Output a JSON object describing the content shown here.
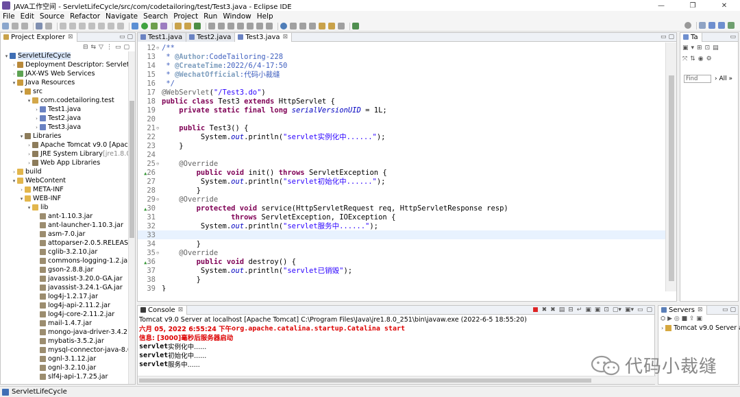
{
  "window": {
    "title": "JAVA工作空间 - ServletLifeCycle/src/com/codetailoring/test/Test3.java - Eclipse IDE",
    "controls": [
      "—",
      "❐",
      "✕"
    ]
  },
  "menu": [
    "File",
    "Edit",
    "Source",
    "Refactor",
    "Navigate",
    "Search",
    "Project",
    "Run",
    "Window",
    "Help"
  ],
  "explorer": {
    "tab_label": "Project Explorer",
    "tree": [
      {
        "label": "ServletLifeCycle",
        "depth": 0,
        "arrow": "▾",
        "icon": "project-icon",
        "selected": true
      },
      {
        "label": "Deployment Descriptor: ServletLifec",
        "depth": 1,
        "arrow": "›",
        "icon": "descriptor-icon"
      },
      {
        "label": "JAX-WS Web Services",
        "depth": 1,
        "arrow": "›",
        "icon": "webservice-icon"
      },
      {
        "label": "Java Resources",
        "depth": 1,
        "arrow": "▾",
        "icon": "resources-icon"
      },
      {
        "label": "src",
        "depth": 2,
        "arrow": "▾",
        "icon": "source-folder-icon"
      },
      {
        "label": "com.codetailoring.test",
        "depth": 3,
        "arrow": "▾",
        "icon": "package-icon"
      },
      {
        "label": "Test1.java",
        "depth": 4,
        "arrow": "›",
        "icon": "java-file-icon"
      },
      {
        "label": "Test2.java",
        "depth": 4,
        "arrow": "›",
        "icon": "java-file-icon"
      },
      {
        "label": "Test3.java",
        "depth": 4,
        "arrow": "›",
        "icon": "java-file-icon"
      },
      {
        "label": "Libraries",
        "depth": 2,
        "arrow": "▾",
        "icon": "library-icon"
      },
      {
        "label": "Apache Tomcat v9.0 [Apache T",
        "depth": 3,
        "arrow": "›",
        "icon": "library-icon"
      },
      {
        "label": "JRE System Library ",
        "suffix": "[jre1.8.0_25",
        "depth": 3,
        "arrow": "›",
        "icon": "library-icon"
      },
      {
        "label": "Web App Libraries",
        "depth": 3,
        "arrow": "›",
        "icon": "library-icon"
      },
      {
        "label": "build",
        "depth": 1,
        "arrow": "›",
        "icon": "folder-icon"
      },
      {
        "label": "WebContent",
        "depth": 1,
        "arrow": "▾",
        "icon": "folder-icon"
      },
      {
        "label": "META-INF",
        "depth": 2,
        "arrow": "›",
        "icon": "folder-icon"
      },
      {
        "label": "WEB-INF",
        "depth": 2,
        "arrow": "▾",
        "icon": "folder-icon"
      },
      {
        "label": "lib",
        "depth": 3,
        "arrow": "▾",
        "icon": "folder-icon"
      },
      {
        "label": "ant-1.10.3.jar",
        "depth": 4,
        "arrow": "",
        "icon": "jar-icon"
      },
      {
        "label": "ant-launcher-1.10.3.jar",
        "depth": 4,
        "arrow": "",
        "icon": "jar-icon"
      },
      {
        "label": "asm-7.0.jar",
        "depth": 4,
        "arrow": "",
        "icon": "jar-icon"
      },
      {
        "label": "attoparser-2.0.5.RELEASE.ja",
        "depth": 4,
        "arrow": "",
        "icon": "jar-icon"
      },
      {
        "label": "cglib-3.2.10.jar",
        "depth": 4,
        "arrow": "",
        "icon": "jar-icon"
      },
      {
        "label": "commons-logging-1.2.jar",
        "depth": 4,
        "arrow": "",
        "icon": "jar-icon"
      },
      {
        "label": "gson-2.8.8.jar",
        "depth": 4,
        "arrow": "",
        "icon": "jar-icon"
      },
      {
        "label": "javassist-3.20.0-GA.jar",
        "depth": 4,
        "arrow": "",
        "icon": "jar-icon"
      },
      {
        "label": "javassist-3.24.1-GA.jar",
        "depth": 4,
        "arrow": "",
        "icon": "jar-icon"
      },
      {
        "label": "log4j-1.2.17.jar",
        "depth": 4,
        "arrow": "",
        "icon": "jar-icon"
      },
      {
        "label": "log4j-api-2.11.2.jar",
        "depth": 4,
        "arrow": "",
        "icon": "jar-icon"
      },
      {
        "label": "log4j-core-2.11.2.jar",
        "depth": 4,
        "arrow": "",
        "icon": "jar-icon"
      },
      {
        "label": "mail-1.4.7.jar",
        "depth": 4,
        "arrow": "",
        "icon": "jar-icon"
      },
      {
        "label": "mongo-java-driver-3.4.2.jar",
        "depth": 4,
        "arrow": "",
        "icon": "jar-icon"
      },
      {
        "label": "mybatis-3.5.2.jar",
        "depth": 4,
        "arrow": "",
        "icon": "jar-icon"
      },
      {
        "label": "mysql-connector-java-8.0.1",
        "depth": 4,
        "arrow": "",
        "icon": "jar-icon"
      },
      {
        "label": "ognl-3.1.12.jar",
        "depth": 4,
        "arrow": "",
        "icon": "jar-icon"
      },
      {
        "label": "ognl-3.2.10.jar",
        "depth": 4,
        "arrow": "",
        "icon": "jar-icon"
      },
      {
        "label": "slf4j-api-1.7.25.jar",
        "depth": 4,
        "arrow": "",
        "icon": "jar-icon"
      }
    ]
  },
  "editor": {
    "tabs": [
      {
        "label": "Test1.java",
        "active": false
      },
      {
        "label": "Test2.java",
        "active": false
      },
      {
        "label": "Test3.java",
        "active": true
      }
    ],
    "lines": [
      {
        "n": "12",
        "fold": "⊖",
        "parts": [
          [
            "cm",
            "/**"
          ]
        ]
      },
      {
        "n": "13",
        "parts": [
          [
            "cm",
            " * "
          ],
          [
            "tag",
            "@Author"
          ],
          [
            "cm",
            ":CodeTailoring-228"
          ]
        ]
      },
      {
        "n": "14",
        "parts": [
          [
            "cm",
            " * "
          ],
          [
            "tag",
            "@CreateTime"
          ],
          [
            "cm",
            ":2022/6/4-17:50"
          ]
        ]
      },
      {
        "n": "15",
        "parts": [
          [
            "cm",
            " * "
          ],
          [
            "tag",
            "@WechatOfficial"
          ],
          [
            "cm",
            ":代码小裁缝"
          ]
        ]
      },
      {
        "n": "16",
        "parts": [
          [
            "cm",
            " */"
          ]
        ]
      },
      {
        "n": "17",
        "parts": [
          [
            "ann",
            "@WebServlet"
          ],
          [
            "",
            "("
          ],
          [
            "str",
            "\"/Test3.do\""
          ],
          [
            "",
            ")"
          ]
        ]
      },
      {
        "n": "18",
        "parts": [
          [
            "kw",
            "public class "
          ],
          [
            "",
            "Test3 "
          ],
          [
            "kw",
            "extends "
          ],
          [
            "",
            "HttpServlet {"
          ]
        ]
      },
      {
        "n": "19",
        "parts": [
          [
            "",
            "    "
          ],
          [
            "kw",
            "private static final long "
          ],
          [
            "fld",
            "serialVersionUID"
          ],
          [
            "",
            " = 1L;"
          ]
        ]
      },
      {
        "n": "20",
        "parts": [
          [
            "",
            ""
          ]
        ]
      },
      {
        "n": "21",
        "fold": "⊖",
        "parts": [
          [
            "",
            "    "
          ],
          [
            "kw",
            "public "
          ],
          [
            "",
            "Test3() {"
          ]
        ]
      },
      {
        "n": "22",
        "parts": [
          [
            "",
            "         System."
          ],
          [
            "stf",
            "out"
          ],
          [
            "",
            ".println("
          ],
          [
            "str",
            "\"servlet实例化中......\""
          ],
          [
            "",
            ");"
          ]
        ]
      },
      {
        "n": "23",
        "parts": [
          [
            "",
            "    }"
          ]
        ]
      },
      {
        "n": "24",
        "parts": [
          [
            "",
            ""
          ]
        ]
      },
      {
        "n": "25",
        "fold": "⊖",
        "parts": [
          [
            "",
            "    "
          ],
          [
            "ann",
            "@Override"
          ]
        ]
      },
      {
        "n": "26",
        "marker": "▲",
        "parts": [
          [
            "",
            "        "
          ],
          [
            "kw",
            "public void "
          ],
          [
            "",
            "init() "
          ],
          [
            "kw",
            "throws "
          ],
          [
            "",
            "ServletException {"
          ]
        ]
      },
      {
        "n": "27",
        "parts": [
          [
            "",
            "         System."
          ],
          [
            "stf",
            "out"
          ],
          [
            "",
            ".println("
          ],
          [
            "str",
            "\"servlet初始化中......\""
          ],
          [
            "",
            ");"
          ]
        ]
      },
      {
        "n": "28",
        "parts": [
          [
            "",
            "        }"
          ]
        ]
      },
      {
        "n": "29",
        "fold": "⊖",
        "parts": [
          [
            "",
            "    "
          ],
          [
            "ann",
            "@Override"
          ]
        ]
      },
      {
        "n": "30",
        "marker": "▲",
        "parts": [
          [
            "",
            "        "
          ],
          [
            "kw",
            "protected void "
          ],
          [
            "",
            "service(HttpServletRequest req, HttpServletResponse resp)"
          ]
        ]
      },
      {
        "n": "31",
        "parts": [
          [
            "",
            "                "
          ],
          [
            "kw",
            "throws "
          ],
          [
            "",
            "ServletException, IOException {"
          ]
        ]
      },
      {
        "n": "32",
        "parts": [
          [
            "",
            "         System."
          ],
          [
            "stf",
            "out"
          ],
          [
            "",
            ".println("
          ],
          [
            "str",
            "\"servlet服务中......\""
          ],
          [
            "",
            ");"
          ]
        ]
      },
      {
        "n": "33",
        "hl": true,
        "parts": [
          [
            "",
            ""
          ]
        ]
      },
      {
        "n": "34",
        "parts": [
          [
            "",
            "        }"
          ]
        ]
      },
      {
        "n": "35",
        "fold": "⊖",
        "parts": [
          [
            "",
            "    "
          ],
          [
            "ann",
            "@Override"
          ]
        ]
      },
      {
        "n": "36",
        "marker": "▲",
        "parts": [
          [
            "",
            "        "
          ],
          [
            "kw",
            "public void "
          ],
          [
            "",
            "destroy() {"
          ]
        ]
      },
      {
        "n": "37",
        "parts": [
          [
            "",
            "         System."
          ],
          [
            "stf",
            "out"
          ],
          [
            "",
            ".println("
          ],
          [
            "str",
            "\"servlet已销毁\""
          ],
          [
            "",
            ");"
          ]
        ]
      },
      {
        "n": "38",
        "parts": [
          [
            "",
            "        }"
          ]
        ]
      },
      {
        "n": "39",
        "parts": [
          [
            "",
            "}"
          ]
        ]
      }
    ]
  },
  "outline": {
    "tab_label": "Ta",
    "find_placeholder": "Find",
    "all_label": "All"
  },
  "console": {
    "tab_label": "Console",
    "header": "Tomcat v9.0 Server at localhost [Apache Tomcat] C:\\Program Files\\Java\\jre1.8.0_251\\bin\\javaw.exe  (2022-6-5 18:55:20)",
    "lines": [
      {
        "style": "red",
        "parts": [
          [
            "cjk",
            "六月 05, 2022 6:55:24 下午 "
          ],
          [
            "mono-bold",
            "org.apache.catalina.startup.Catalina start"
          ]
        ]
      },
      {
        "style": "red",
        "parts": [
          [
            "cjk",
            "信息: [3000]毫秒后服务器启动"
          ]
        ]
      },
      {
        "style": "black",
        "parts": [
          [
            "mono-bold",
            "servlet"
          ],
          [
            "cjk",
            "实例化中......"
          ]
        ]
      },
      {
        "style": "black",
        "parts": [
          [
            "mono-bold",
            "servlet"
          ],
          [
            "cjk",
            "初始化中......"
          ]
        ]
      },
      {
        "style": "black",
        "parts": [
          [
            "mono-bold",
            "servlet"
          ],
          [
            "cjk",
            "服务中......"
          ]
        ]
      }
    ]
  },
  "servers": {
    "tab_label": "Servers",
    "item": "Tomcat v9.0 Server at"
  },
  "watermark": {
    "text": "代码小裁缝"
  },
  "statusbar": {
    "text": "ServletLifeCycle"
  }
}
